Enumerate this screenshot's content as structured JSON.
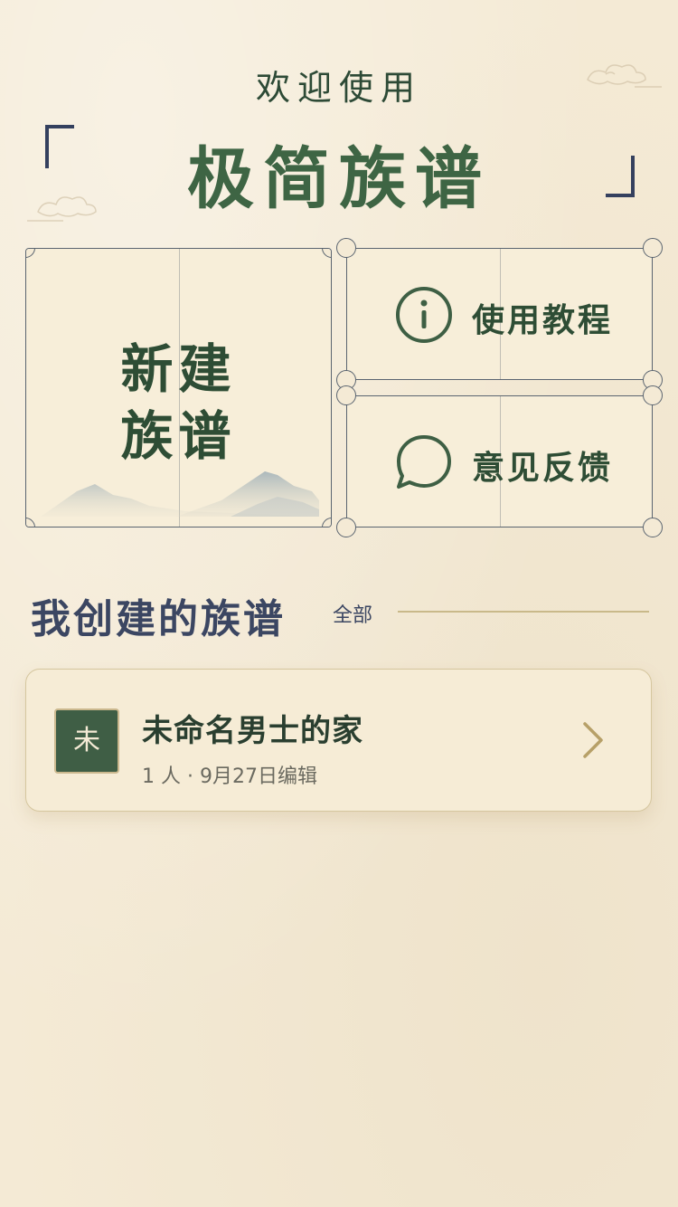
{
  "header": {
    "welcome": "欢迎使用",
    "app_name": "极简族谱"
  },
  "actions": {
    "new_line1": "新建",
    "new_line2": "族谱",
    "tutorial": "使用教程",
    "feedback": "意见反馈"
  },
  "section": {
    "title": "我创建的族谱",
    "all": "全部"
  },
  "families": [
    {
      "avatar_char": "未",
      "name": "未命名男士的家",
      "meta": "1 人 · 9月27日编辑"
    }
  ],
  "colors": {
    "background": "#f4ead5",
    "primary_green": "#3e6544",
    "navy": "#3b4662",
    "gold": "#c9b98a"
  }
}
